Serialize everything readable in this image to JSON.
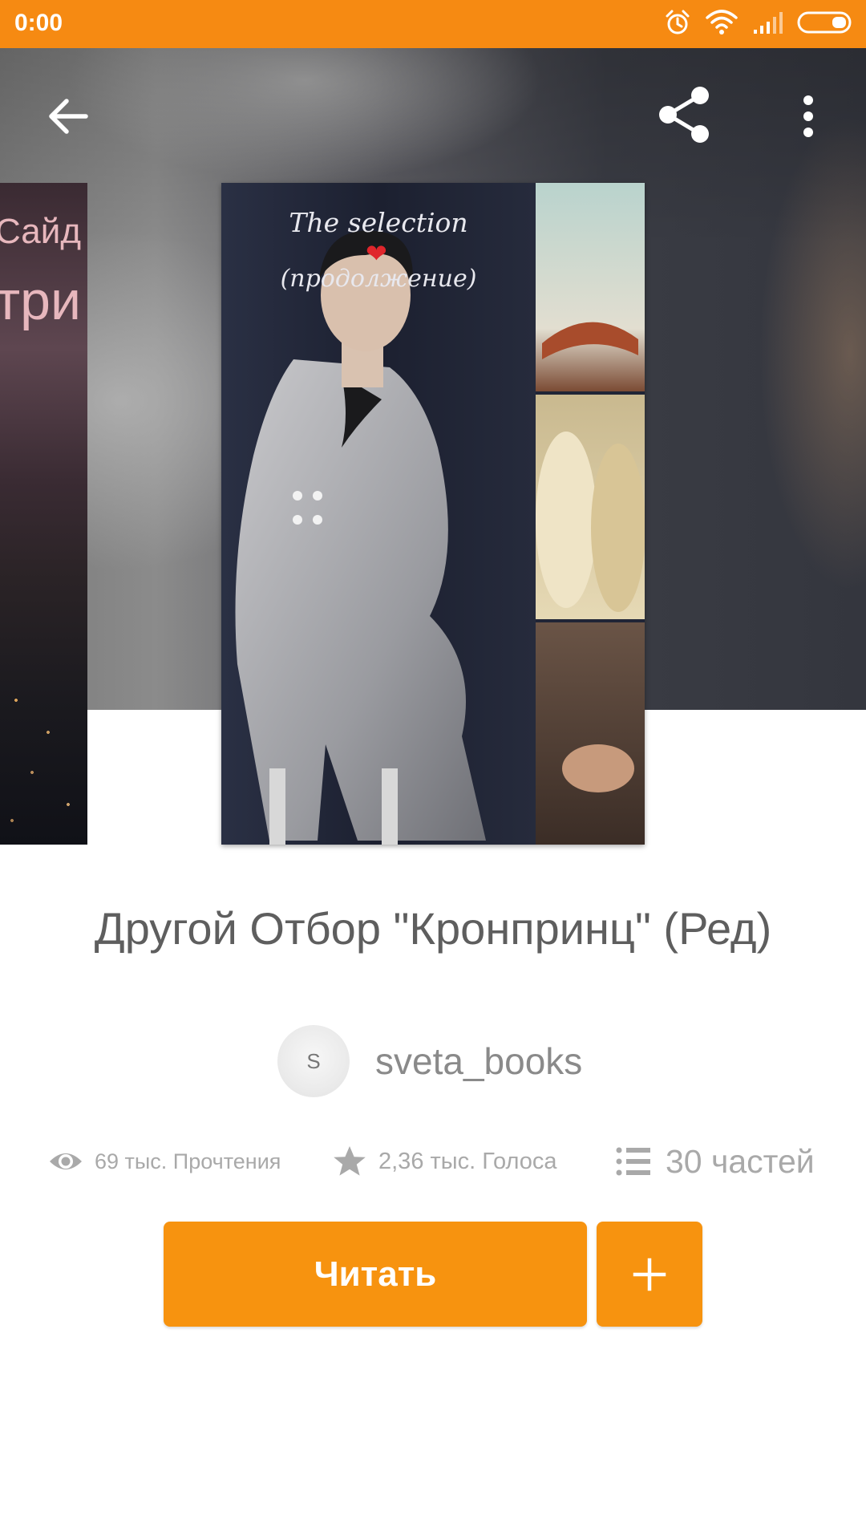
{
  "status_bar": {
    "time": "0:00",
    "icons": [
      "alarm-icon",
      "wifi-icon",
      "signal-icon",
      "battery-icon"
    ],
    "background_color": "#f68a12"
  },
  "toolbar": {
    "back_icon": "arrow-left-icon",
    "share_icon": "share-icon",
    "more_icon": "more-vertical-icon"
  },
  "covers": {
    "previous_cover_text": [
      "Сайд",
      "три"
    ],
    "current_cover_text": {
      "line1": "The selection",
      "heart": "❤",
      "line2": "(продолжение)"
    }
  },
  "story": {
    "title": "Другой Отбор \"Кронпринц\"  (Ред)",
    "author": {
      "avatar_letter": "S",
      "name": "sveta_books"
    },
    "stats": {
      "reads": "69 тыс. Прочтения",
      "votes": "2,36 тыс. Голоса",
      "parts": "30 частей"
    }
  },
  "actions": {
    "read_label": "Читать",
    "add_icon": "plus-icon",
    "accent_color": "#f7930f"
  }
}
